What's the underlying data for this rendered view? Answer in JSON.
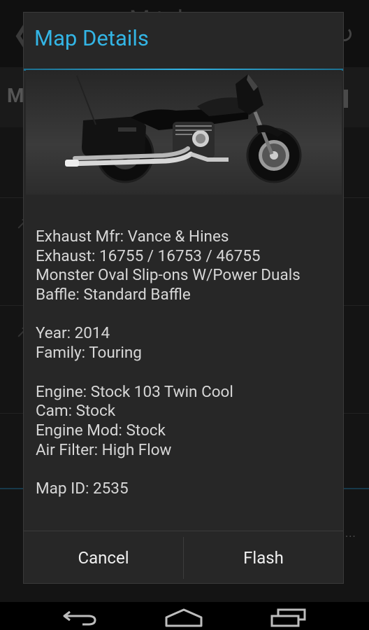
{
  "background": {
    "title_fragment": "M   t  d",
    "tab_letter": "M",
    "overflow": "..."
  },
  "dialog": {
    "title": "Map Details",
    "image_alt": "Motorcycle with Vance & Hines exhaust",
    "lines": [
      "Exhaust Mfr: Vance & Hines",
      "Exhaust: 16755 / 16753 / 46755",
      "Monster Oval Slip-ons W/Power Duals",
      "Baffle: Standard Baffle",
      "Year: 2014",
      "Family: Touring",
      "Engine: Stock 103 Twin Cool",
      "Cam: Stock",
      "Engine Mod: Stock",
      "Air Filter: High Flow",
      "Map ID: 2535"
    ],
    "buttons": {
      "cancel": "Cancel",
      "flash": "Flash"
    }
  },
  "colors": {
    "accent": "#33b5e5",
    "dialog_bg": "#272727",
    "text": "#d7d7d7"
  },
  "navbar": {
    "icons": [
      "back-icon",
      "home-icon",
      "recent-apps-icon"
    ]
  }
}
